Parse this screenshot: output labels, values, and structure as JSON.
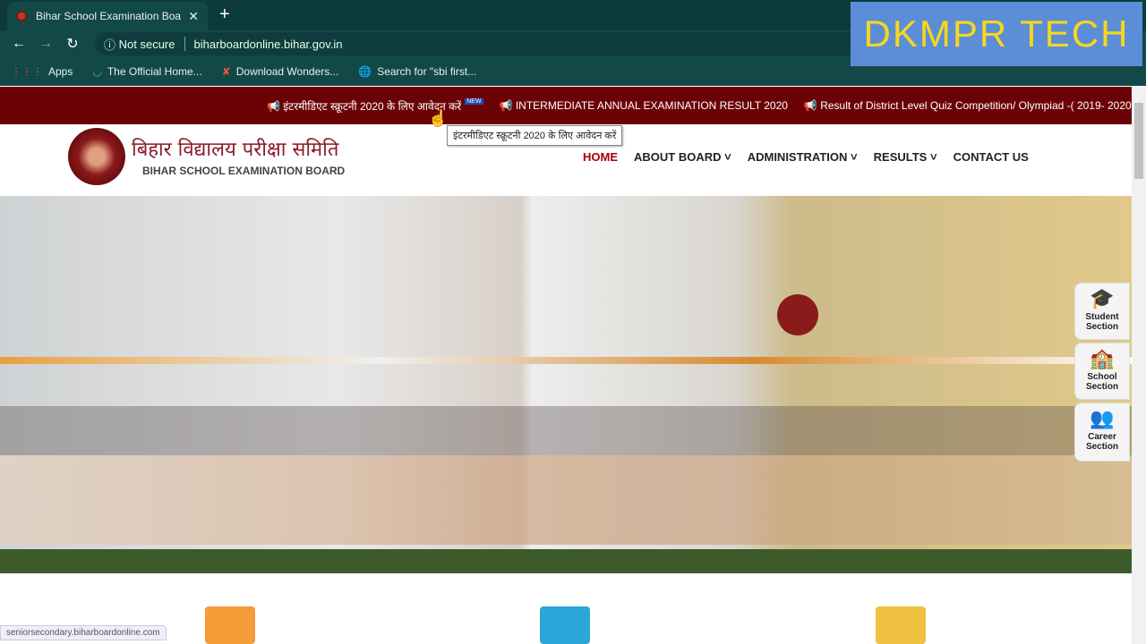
{
  "browser": {
    "tab_title": "Bihar School Examination Board",
    "security": "Not secure",
    "url": "biharboardonline.bihar.gov.in",
    "bookmarks": [
      "Apps",
      "The Official Home...",
      "Download Wonders...",
      "Search for \"sbi first..."
    ]
  },
  "watermark": "DKMPR TECH",
  "ticker": {
    "items": [
      "इंटरमीडिएट स्क्रूटनी 2020 के लिए आवेदन करें",
      "INTERMEDIATE ANNUAL EXAMINATION RESULT 2020",
      "Result of District Level Quiz Competition/ Olympiad -( 2019- 2020"
    ],
    "new_badge": "NEW",
    "tooltip": "इंटरमीडिएट स्क्रूटनी 2020 के लिए आवेदन करें"
  },
  "header": {
    "title_hindi": "बिहार विद्यालय परीक्षा समिति",
    "title_english": "BIHAR SCHOOL EXAMINATION BOARD"
  },
  "nav": [
    "HOME",
    "ABOUT BOARD",
    "ADMINISTRATION",
    "RESULTS",
    "CONTACT US"
  ],
  "side": [
    {
      "l1": "Student",
      "l2": "Section"
    },
    {
      "l1": "School",
      "l2": "Section"
    },
    {
      "l1": "Career",
      "l2": "Section"
    }
  ],
  "status_url": "seniorsecondary.biharboardonline.com"
}
